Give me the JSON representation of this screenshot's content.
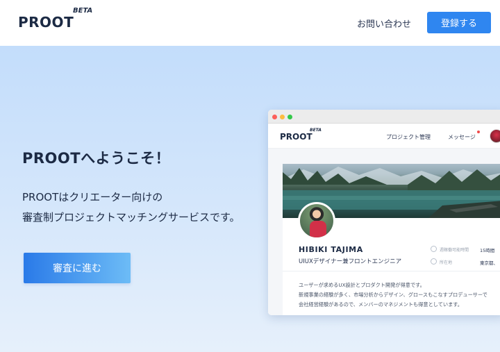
{
  "header": {
    "logo": "PROOT",
    "beta": "BETA",
    "contact_label": "お問い合わせ",
    "register_label": "登録する"
  },
  "hero": {
    "title": "PROOTへようこそ！",
    "description_line1": "PROOTはクリエーター向けの",
    "description_line2": "審査制プロジェクトマッチングサービスです。",
    "cta_label": "審査に進む"
  },
  "mockup": {
    "nav": {
      "logo": "PROOT",
      "beta": "BETA",
      "project_label": "プロジェクト管理",
      "message_label": "メッセージ"
    },
    "profile": {
      "name": "HIBIKI TAJIMA",
      "role": "UIUXデザイナー兼フロントエンジニア",
      "available_label": "週稼働可能時間",
      "available_value": "15時間",
      "location_label": "所在地",
      "location_value": "東京都、",
      "bio": [
        "ユーザーが求めるUX設計とプロダクト開発が得意です。",
        "新規事業の経験が多く、市場分析からデザイン、グロースもこなすプロデューサーで",
        "会社経営経験があるので、メンバーのマネジメントも得意としています。"
      ]
    }
  },
  "colors": {
    "brand_blue": "#2f86f0",
    "navy_text": "#1c2a44",
    "hero_bg": "#c3ddfb"
  }
}
